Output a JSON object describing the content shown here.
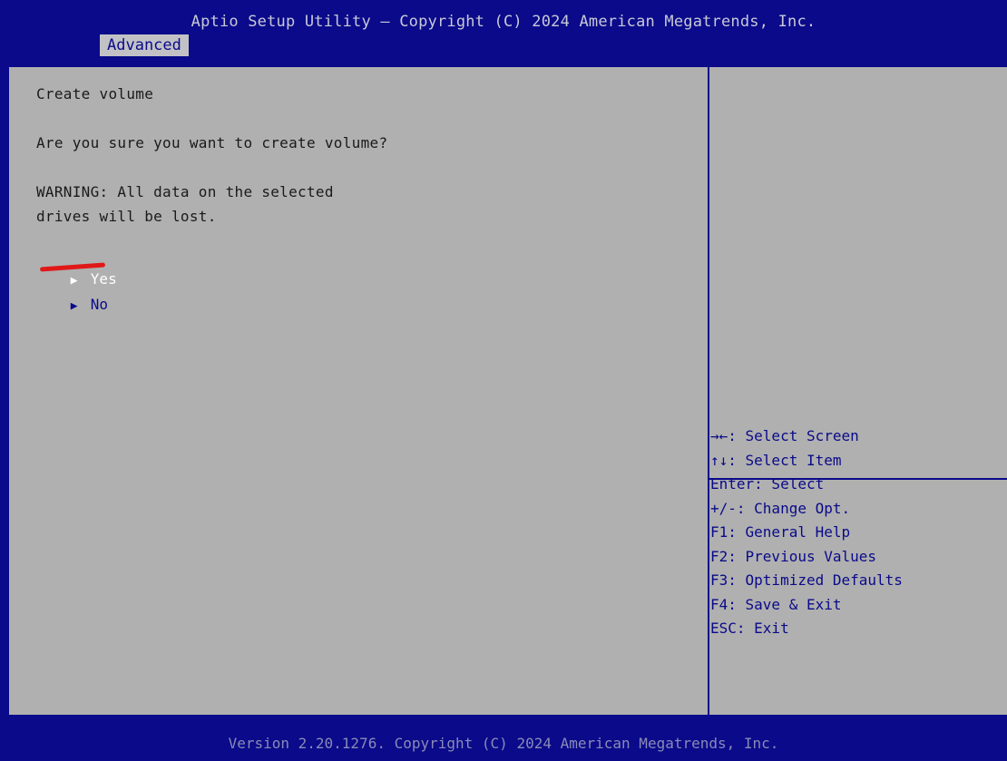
{
  "header": {
    "title": "Aptio Setup Utility – Copyright (C) 2024 American Megatrends, Inc.",
    "tab_label": "Advanced"
  },
  "dialog": {
    "heading": "Create volume",
    "question": "Are you sure you want to create volume?",
    "warning_line1": "WARNING: All data on the selected",
    "warning_line2": "drives will be lost.",
    "options": [
      {
        "label": "Yes",
        "selected": true
      },
      {
        "label": "No",
        "selected": false
      }
    ]
  },
  "help": {
    "items": [
      "→←: Select Screen",
      "↑↓: Select Item",
      "Enter: Select",
      "+/-: Change Opt.",
      "F1: General Help",
      "F2: Previous Values",
      "F3: Optimized Defaults",
      "F4: Save & Exit",
      "ESC: Exit"
    ]
  },
  "footer": {
    "text": "Version 2.20.1276. Copyright (C) 2024 American Megatrends, Inc."
  },
  "colors": {
    "bios_blue": "#0a0a8a",
    "panel_gray": "#b0b0b0",
    "tab_bg": "#c2c2c6",
    "selected_text": "#ffffff",
    "annotation_red": "#e01818"
  },
  "icons": {
    "option_arrow": "right-triangle-icon"
  }
}
